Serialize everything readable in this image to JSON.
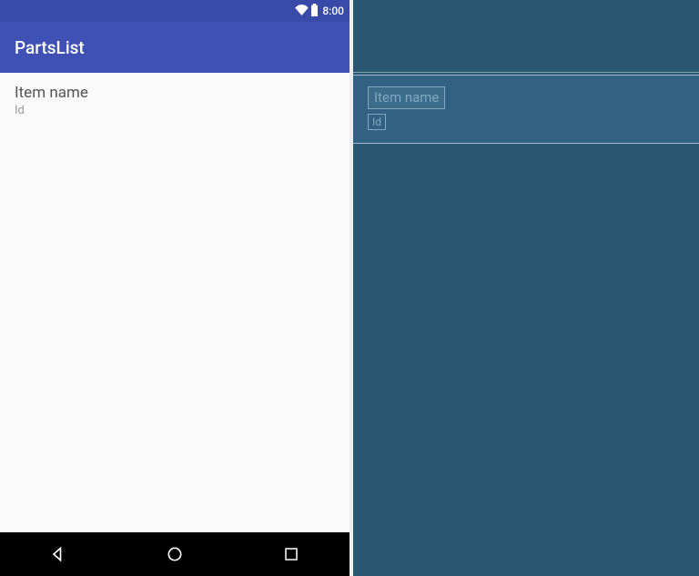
{
  "statusbar": {
    "time": "8:00"
  },
  "appbar": {
    "title": "PartsList"
  },
  "list": {
    "item_name": "Item name",
    "item_id": "Id"
  },
  "blueprint": {
    "item_name": "Item name",
    "item_id": "Id"
  },
  "colors": {
    "primary": "#3f51b5",
    "primary_dark": "#3a4aa8",
    "blueprint_bg": "#2a5670"
  }
}
